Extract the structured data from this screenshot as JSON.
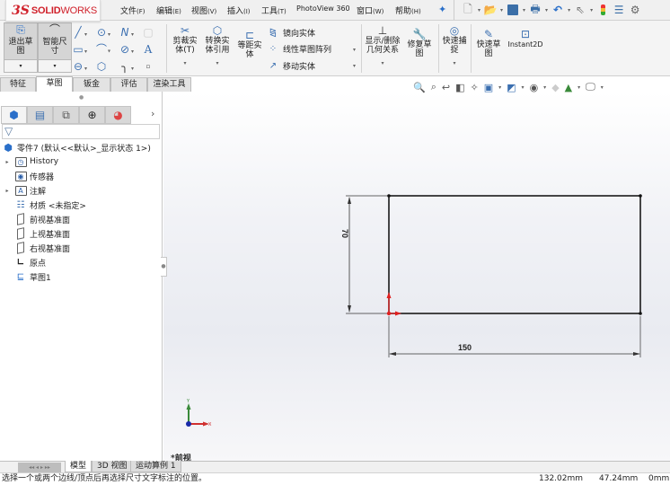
{
  "app": {
    "logo_prefix": "3S",
    "logo_solid": "SOLID",
    "logo_works": "WORKS",
    "brand_color": "#d0202a"
  },
  "menu": [
    {
      "label": "文件",
      "key": "(F)"
    },
    {
      "label": "编辑",
      "key": "(E)"
    },
    {
      "label": "视图",
      "key": "(V)"
    },
    {
      "label": "插入",
      "key": "(I)"
    },
    {
      "label": "工具",
      "key": "(T)"
    },
    {
      "label": "PhotoView 360",
      "key": ""
    },
    {
      "label": "窗口",
      "key": "(W)"
    },
    {
      "label": "帮助",
      "key": "(H)"
    }
  ],
  "quick_access": [
    "new-icon",
    "open-icon",
    "save-icon",
    "print-icon",
    "undo-icon",
    "select-icon",
    "rebuild-icon",
    "file-properties-icon",
    "options-icon"
  ],
  "commands": {
    "exit_sketch": "退出草图",
    "smart_dimension": "智能尺寸",
    "trim": "剪裁实体(T)",
    "convert": "转换实体引用",
    "offset": "等距实体",
    "mirror": "镜向实体",
    "linear_pattern": "线性草图阵列",
    "move": "移动实体",
    "relations": "显示/删除几何关系",
    "repair": "修复草图",
    "quick_snaps": "快速捕捉",
    "rapid_sketch": "快速草图",
    "instant2d": "Instant2D"
  },
  "tabs": [
    {
      "label": "特征",
      "active": false
    },
    {
      "label": "草图",
      "active": true
    },
    {
      "label": "钣金",
      "active": false
    },
    {
      "label": "评估",
      "active": false
    },
    {
      "label": "渲染工具",
      "active": false
    }
  ],
  "panel_tabs": [
    "feature-manager-icon",
    "property-manager-icon",
    "configuration-manager-icon",
    "dimxpert-icon",
    "display-manager-icon"
  ],
  "tree": {
    "root": "零件7 (默认<<默认>_显示状态 1>)",
    "items": [
      {
        "label": "History",
        "expandable": true,
        "icon": "history-folder-icon"
      },
      {
        "label": "传感器",
        "expandable": false,
        "icon": "sensors-folder-icon"
      },
      {
        "label": "注解",
        "expandable": true,
        "icon": "annotations-folder-icon"
      },
      {
        "label": "材质 <未指定>",
        "expandable": false,
        "icon": "material-icon"
      },
      {
        "label": "前视基准面",
        "expandable": false,
        "icon": "plane-icon"
      },
      {
        "label": "上视基准面",
        "expandable": false,
        "icon": "plane-icon"
      },
      {
        "label": "右视基准面",
        "expandable": false,
        "icon": "plane-icon"
      },
      {
        "label": "原点",
        "expandable": false,
        "icon": "origin-icon"
      },
      {
        "label": "草图1",
        "expandable": false,
        "icon": "sketch-icon"
      }
    ]
  },
  "sketch": {
    "width_dim": "150",
    "height_dim": "70",
    "line_color": "#1a1a1a",
    "origin_color": "#e02020"
  },
  "triad": {
    "y_label": "Y",
    "x_label": "X"
  },
  "view_name": "*前视",
  "bottom_tabs": [
    {
      "label": "模型",
      "active": true
    },
    {
      "label": "3D 视图",
      "active": false
    },
    {
      "label": "运动算例 1",
      "active": false
    }
  ],
  "status": {
    "message": "选择一个或两个边线/顶点后再选择尺寸文字标注的位置。",
    "x": "132.02mm",
    "y": "47.24mm",
    "z": "0mm"
  }
}
